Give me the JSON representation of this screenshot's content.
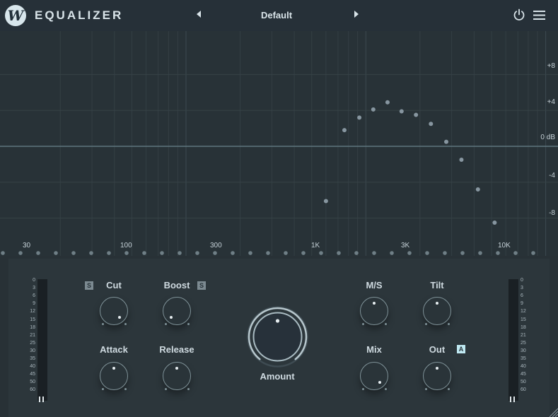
{
  "header": {
    "logo_letter": "W",
    "title": "EQUALIZER",
    "preset": "Default",
    "icons": [
      "power-icon",
      "menu-icon"
    ]
  },
  "graph": {
    "db_labels": [
      "+8",
      "+4",
      "0 dB",
      "-4",
      "-8"
    ],
    "freq_labels": [
      "30",
      "100",
      "300",
      "1K",
      "3K",
      "10K"
    ]
  },
  "chart_data": {
    "type": "scatter",
    "xscale": "log",
    "ylim": [
      -10,
      10
    ],
    "y_ticks": [
      "+8",
      "+4",
      "0 dB",
      "-4",
      "-8"
    ],
    "x_ticks": [
      "30",
      "100",
      "300",
      "1K",
      "3K",
      "10K"
    ],
    "points": [
      {
        "x": 600,
        "y": -6.1
      },
      {
        "x": 760,
        "y": 1.8
      },
      {
        "x": 920,
        "y": 3.2
      },
      {
        "x": 1100,
        "y": 4.1
      },
      {
        "x": 1320,
        "y": 4.9
      },
      {
        "x": 1580,
        "y": 3.9
      },
      {
        "x": 1900,
        "y": 3.5
      },
      {
        "x": 2300,
        "y": 2.5
      },
      {
        "x": 2800,
        "y": 0.5
      },
      {
        "x": 3400,
        "y": -1.5
      },
      {
        "x": 4200,
        "y": -4.8
      },
      {
        "x": 5200,
        "y": -8.5
      }
    ],
    "baseline_db": 0
  },
  "meters": {
    "scale": [
      "0",
      "3",
      "6",
      "9",
      "12",
      "15",
      "18",
      "21",
      "25",
      "30",
      "35",
      "40",
      "45",
      "50",
      "60"
    ]
  },
  "controls": {
    "cut": {
      "label": "Cut",
      "solo": "S"
    },
    "boost": {
      "label": "Boost",
      "solo": "S"
    },
    "attack": {
      "label": "Attack"
    },
    "release": {
      "label": "Release"
    },
    "amount": {
      "label": "Amount"
    },
    "ms": {
      "label": "M/S"
    },
    "tilt": {
      "label": "Tilt"
    },
    "mix": {
      "label": "Mix"
    },
    "out": {
      "label": "Out",
      "auto": "A"
    }
  },
  "colors": {
    "background": "#1d2327",
    "header": "#263038",
    "graph": "#283237",
    "accent": "#bfe9f2",
    "knob_ring": "#7f9298"
  }
}
